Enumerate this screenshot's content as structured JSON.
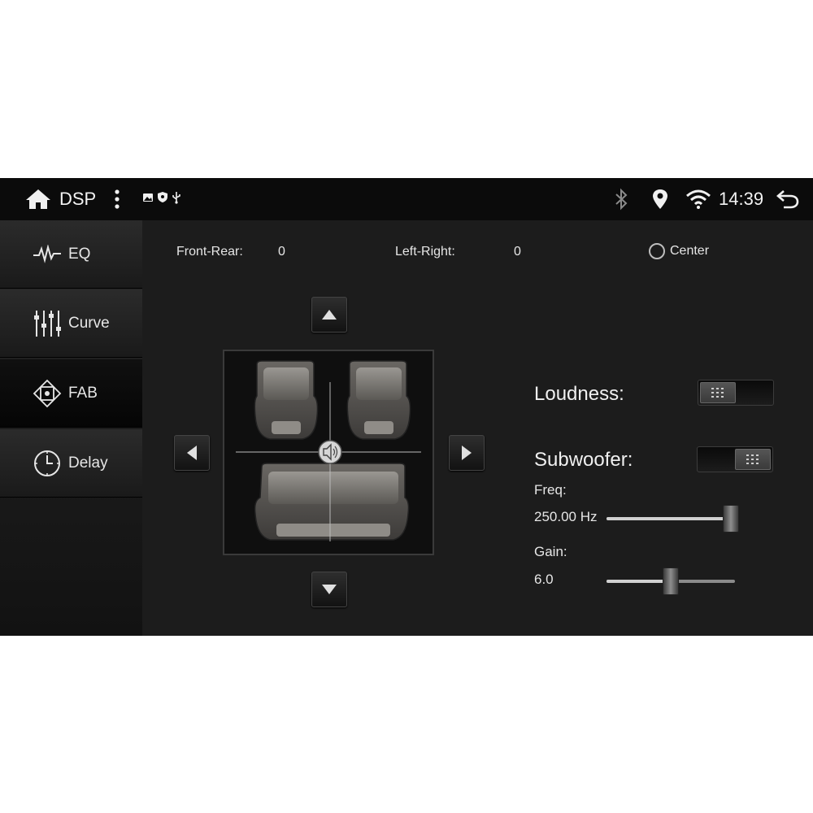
{
  "statusbar": {
    "app_title": "DSP",
    "time": "14:39",
    "icons": [
      "home-icon",
      "more-vert-icon",
      "image-icon",
      "shield-icon",
      "usb-icon",
      "bluetooth-icon",
      "location-icon",
      "wifi-icon",
      "back-icon"
    ]
  },
  "sidebar": {
    "items": [
      {
        "label": "EQ",
        "icon": "waveform-icon",
        "active": false
      },
      {
        "label": "Curve",
        "icon": "sliders-icon",
        "active": false
      },
      {
        "label": "FAB",
        "icon": "balance-arrows-icon",
        "active": true
      },
      {
        "label": "Delay",
        "icon": "clock-icon",
        "active": false
      }
    ]
  },
  "balance": {
    "front_rear_label": "Front-Rear:",
    "front_rear_value": "0",
    "left_right_label": "Left-Right:",
    "left_right_value": "0",
    "center_label": "Center",
    "center_selected": false
  },
  "settings": {
    "loudness_label": "Loudness:",
    "loudness_on": false,
    "subwoofer_label": "Subwoofer:",
    "subwoofer_on": true,
    "freq_label": "Freq:",
    "freq_value": "250.00 Hz",
    "freq_level": 0.97,
    "gain_label": "Gain:",
    "gain_value": "6.0",
    "gain_level": 0.5
  },
  "colors": {
    "screen_bg": "#1c1c1c",
    "statusbar_bg": "#0b0b0b",
    "text": "#e6e6e6"
  }
}
